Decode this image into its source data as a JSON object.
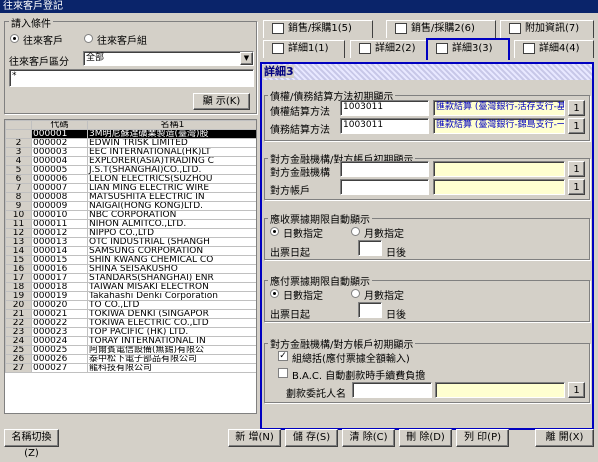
{
  "window": {
    "title": "往來客戶登記"
  },
  "search": {
    "group_title": "請入條件",
    "radio_customer": "往來客戶",
    "radio_customer_group": "往來客戶組",
    "region_label": "往來客戶區分",
    "region_value": "全部",
    "keyword_value": "*",
    "show_button": "顯 示(K)"
  },
  "grid": {
    "col_code": "代碼",
    "col_name": "名稱1",
    "rows": [
      {
        "n": "",
        "code": "000001",
        "name": "3M明尼蘇達礦業製造(臺灣)股"
      },
      {
        "n": "2",
        "code": "000002",
        "name": "EDWIN TRISK LIMITED"
      },
      {
        "n": "3",
        "code": "000003",
        "name": "EEC INTERNATIONAL(HK)LT"
      },
      {
        "n": "4",
        "code": "000004",
        "name": "EXPLORER(ASIA)TRADING C"
      },
      {
        "n": "5",
        "code": "000005",
        "name": "J.S.T(SHANGHAI)CO.,LTD."
      },
      {
        "n": "6",
        "code": "000006",
        "name": "LELON ELECTRICS(SUZHOU"
      },
      {
        "n": "7",
        "code": "000007",
        "name": "LIAN MING ELECTRIC WIRE"
      },
      {
        "n": "8",
        "code": "000008",
        "name": "MATSUSHITA ELECTRIC IN"
      },
      {
        "n": "9",
        "code": "000009",
        "name": "NAIGAI(HONG KONG)LTD."
      },
      {
        "n": "10",
        "code": "000010",
        "name": "NBC CORPORATION"
      },
      {
        "n": "11",
        "code": "000011",
        "name": "NIHON ALMITCO.,LTD."
      },
      {
        "n": "12",
        "code": "000012",
        "name": "NIPPO CO.,LTD"
      },
      {
        "n": "13",
        "code": "000013",
        "name": "OTC INDUSTRIAL (SHANGH"
      },
      {
        "n": "14",
        "code": "000014",
        "name": "SAMSUNG CORPORATION"
      },
      {
        "n": "15",
        "code": "000015",
        "name": "SHIN KWANG CHEMICAL CO"
      },
      {
        "n": "16",
        "code": "000016",
        "name": "SHINA SEISAKUSHO"
      },
      {
        "n": "17",
        "code": "000017",
        "name": "STANDARS(SHANGHAI) ENR"
      },
      {
        "n": "18",
        "code": "000018",
        "name": "TAIWAN MISAKI ELECTRON"
      },
      {
        "n": "19",
        "code": "000019",
        "name": "Takahashi Denki Corporation"
      },
      {
        "n": "20",
        "code": "000020",
        "name": "TO CO.,LTD"
      },
      {
        "n": "21",
        "code": "000021",
        "name": "TOKIWA DENKI (SINGAPOR"
      },
      {
        "n": "22",
        "code": "000022",
        "name": "TOKIWA ELECTRIC CO.,LTD"
      },
      {
        "n": "23",
        "code": "000023",
        "name": "TOP PACIFIC (HK) LTD."
      },
      {
        "n": "24",
        "code": "000024",
        "name": "TORAY INTERNATIONAL IN"
      },
      {
        "n": "25",
        "code": "000025",
        "name": "阿爾賓電信設備(無錫)有限公"
      },
      {
        "n": "26",
        "code": "000026",
        "name": "泰中松下電子部品有限公司"
      },
      {
        "n": "27",
        "code": "000027",
        "name": "龍科技有限公司"
      }
    ]
  },
  "tabs": {
    "sales": "銷售/採購1(5)",
    "sales2": "銷售/採購2(6)",
    "extra": "附加資訊(7)",
    "detail1": "詳細1(1)",
    "detail2": "詳細2(2)",
    "detail3": "詳細3(3)",
    "detail4": "詳細4(4)"
  },
  "panel": {
    "title": "詳細3",
    "settle": {
      "title": "債權/債務結算方法初期顯示",
      "receivable_label": "債權結算方法",
      "receivable_code": "1003011",
      "receivable_name": "匯款結算 (臺灣銀行-活存支行-基",
      "payable_label": "債務結算方法",
      "payable_code": "1003011",
      "payable_name": "匯款結算 (臺灣銀行-錦島支行-一"
    },
    "bank": {
      "title": "對方金融機構/對方帳戶初期顯示",
      "bank_label": "對方金融機構",
      "account_label": "對方帳戶"
    },
    "recv_date": {
      "title": "應收票據期限自動顯示",
      "opt_day": "日數指定",
      "opt_month": "月數指定",
      "date_label": "出票日起",
      "unit": "日後"
    },
    "pay_date": {
      "title": "應付票據期限自動顯示",
      "opt_day": "日數指定",
      "opt_month": "月數指定",
      "date_label": "出票日起",
      "unit": "日後"
    },
    "trust": {
      "title": "對方金融機構/對方帳戶初期顯示",
      "check1": "組總括(應付票據全額輸入)",
      "check2": "B.A.C. 自動劃款時手續費負擔",
      "trustee_label": "劃款委託人名"
    },
    "lookup_btn": "1"
  },
  "footer": {
    "name_switch": "名稱切換(Z)",
    "new": "新 增(N)",
    "save": "儲 存(S)",
    "clear": "清 除(C)",
    "delete": "刪 除(D)",
    "print": "列 印(P)",
    "close": "離 開(X)"
  }
}
